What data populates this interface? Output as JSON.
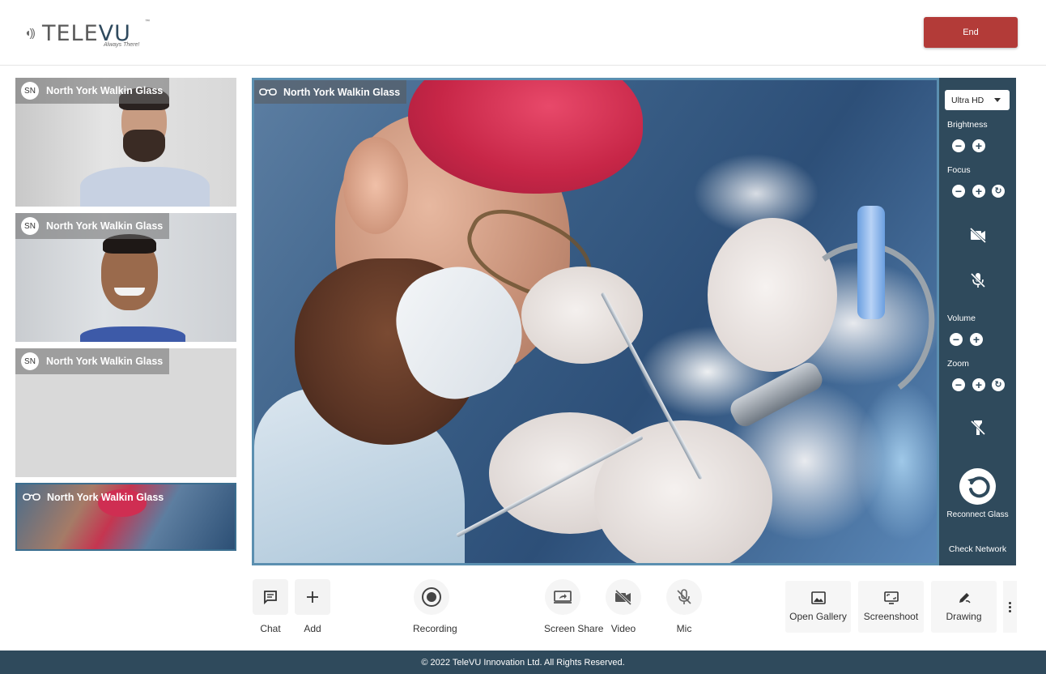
{
  "header": {
    "logo_text": "TELEVU",
    "logo_trademark": "™",
    "logo_tagline": "Always There!",
    "end_button": "End"
  },
  "participants": [
    {
      "initials": "SN",
      "name": "North York Walkin Glass"
    },
    {
      "initials": "SN",
      "name": "North York Walkin Glass"
    },
    {
      "initials": "SN",
      "name": "North York Walkin Glass"
    },
    {
      "name": "North York Walkin Glass",
      "icon": "glasses-icon"
    }
  ],
  "main_video": {
    "label": "North York Walkin Glass",
    "icon": "glasses-icon"
  },
  "controls": {
    "quality_selected": "Ultra HD",
    "brightness_label": "Brightness",
    "focus_label": "Focus",
    "volume_label": "Volume",
    "zoom_label": "Zoom",
    "reconnect_label": "Reconnect Glass",
    "check_network_label": "Check Network"
  },
  "toolbar": {
    "chat": "Chat",
    "add": "Add",
    "recording": "Recording",
    "screen_share": "Screen Share",
    "video": "Video",
    "mic": "Mic",
    "open_gallery": "Open Gallery",
    "screenshoot": "Screenshoot",
    "drawing": "Drawing"
  },
  "footer": {
    "copyright": "© 2022 TeleVU Innovation Ltd. All Rights Reserved."
  },
  "colors": {
    "brand_dark": "#2f4a5c",
    "end_red": "#b33b38",
    "frame_blue": "#5b8fb0"
  }
}
